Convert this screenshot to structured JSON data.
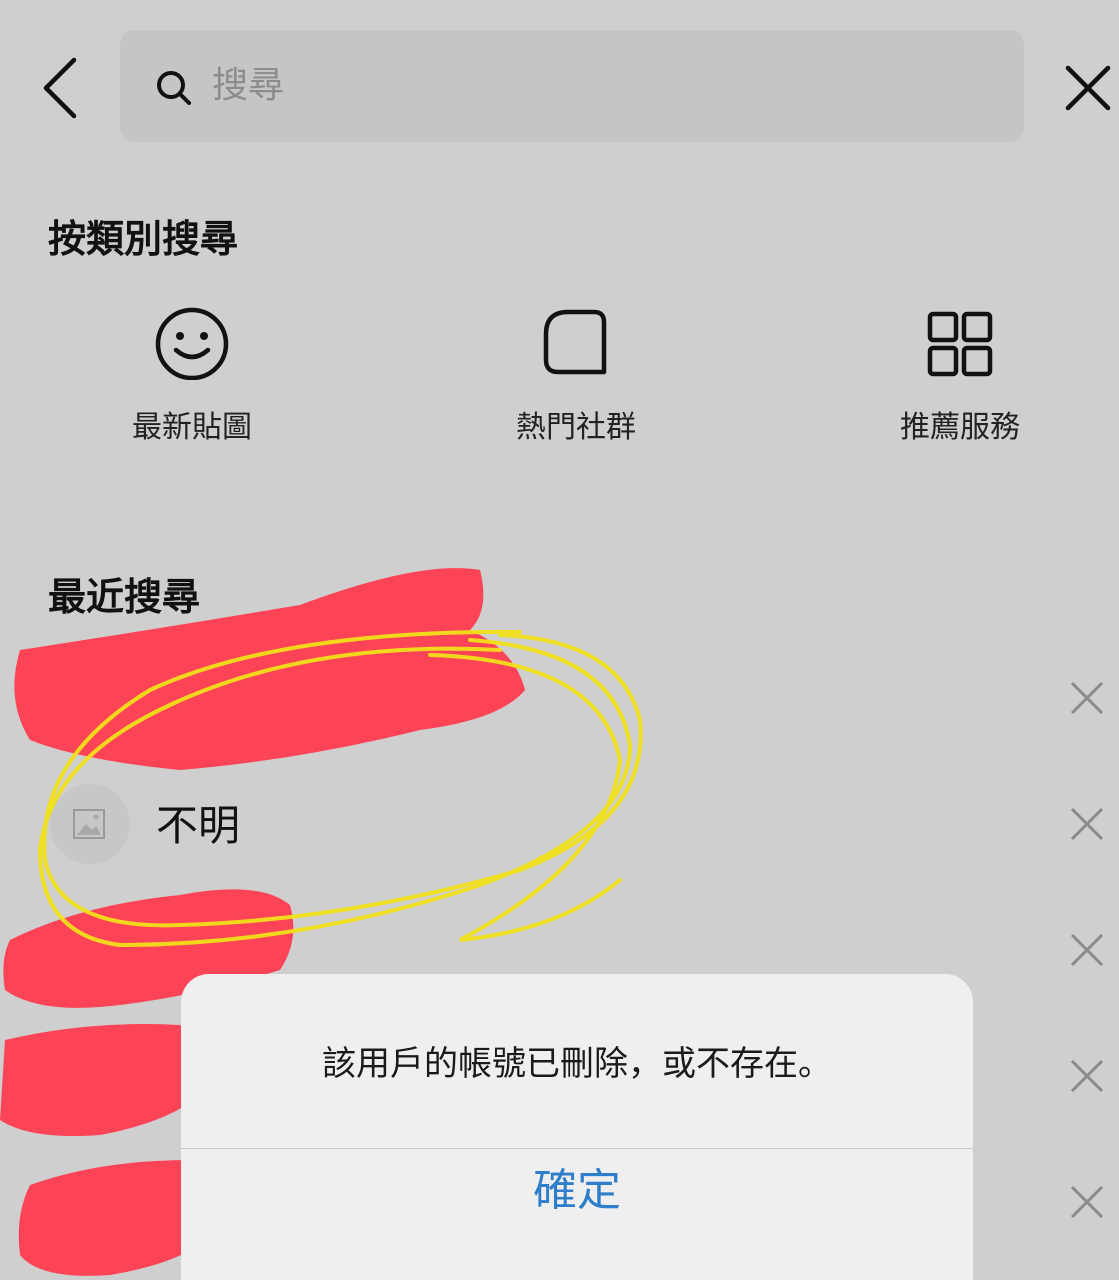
{
  "header": {
    "back_icon": "chevron-left-icon",
    "search_icon": "search-icon",
    "search_placeholder": "搜尋",
    "close_icon": "close-icon"
  },
  "categories": {
    "title": "按類別搜尋",
    "items": [
      {
        "label": "最新貼圖",
        "icon": "smiley-icon"
      },
      {
        "label": "熱門社群",
        "icon": "rounded-square-icon"
      },
      {
        "label": "推薦服務",
        "icon": "grid-icon"
      }
    ]
  },
  "recent": {
    "title": "最近搜尋",
    "items": [
      {
        "name": "",
        "redacted": true
      },
      {
        "name": "不明",
        "avatar_icon": "image-placeholder-icon"
      },
      {
        "name": "",
        "redacted": true
      },
      {
        "name": "",
        "redacted": true
      },
      {
        "name": "",
        "redacted": true
      }
    ],
    "remove_icon": "close-icon"
  },
  "dialog": {
    "message": "該用戶的帳號已刪除，或不存在。",
    "ok_label": "確定",
    "ok_color": "#2f7ec9"
  },
  "colors": {
    "background": "#cfcfcf",
    "redaction": "#ff3b4f",
    "highlight": "#f2e11a"
  }
}
